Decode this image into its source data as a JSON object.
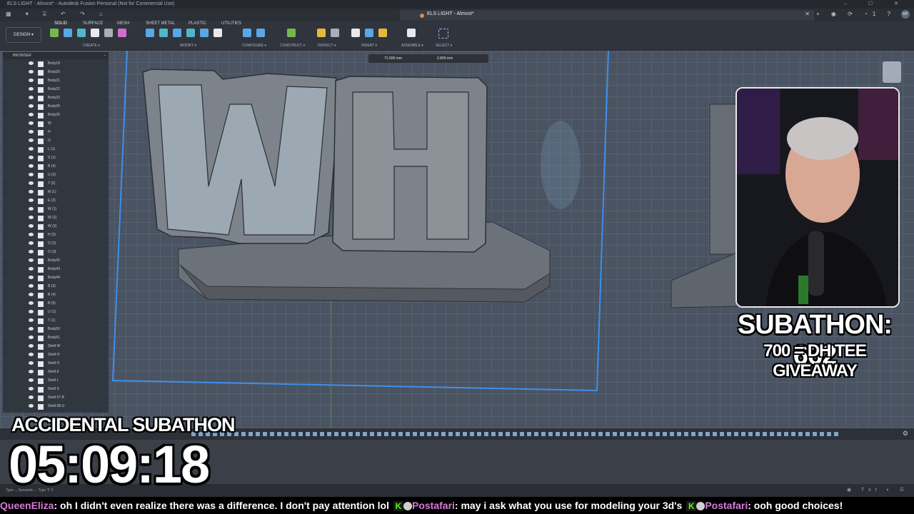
{
  "titlebar": {
    "title": "ELS LIGHT - Almost* - Autodesk Fusion Personal (Not for Commercial Use)",
    "controls": "–  ☐  ✕"
  },
  "tabbar": {
    "doc_tab": "ELS LIGHT - Almost*",
    "close": "✕",
    "right_icons": "+  ◉  ⟳  ◔1  ?",
    "avatar": "KP"
  },
  "toolbar": {
    "workspace": "DESIGN ▾",
    "tabs": [
      "SOLID",
      "SURFACE",
      "MESH",
      "SHEET METAL",
      "PLASTIC",
      "UTILITIES"
    ],
    "groups": [
      "CREATE ▾",
      "MODIFY ▾",
      "CONFIGURE ▾",
      "CONSTRUCT ▾",
      "INSPECT ▾",
      "INSERT ▾",
      "ASSEMBLE ▾",
      "SELECT ▾"
    ]
  },
  "measure": {
    "value1": "71.506 mm",
    "value2": "2.809 mm"
  },
  "browser": {
    "title": "BROWSER",
    "min": "–",
    "items": [
      "Body19",
      "Body20",
      "Body21",
      "Body22",
      "Body23",
      "Body24",
      "Body25",
      "W",
      "H",
      "O",
      "L (1)",
      "S (1)",
      "B (4)",
      "U (2)",
      "T (2)",
      "M (1)",
      "E (2)",
      "W (1)",
      "W (2)",
      "W (3)",
      "H (2)",
      "O (2)",
      "O (3)",
      "Body42",
      "Body43",
      "Body44",
      "B (3)",
      "B (4)",
      "B (5)",
      "U (1)",
      "T (1)",
      "Body50",
      "Body51",
      "Shell W",
      "Shell H",
      "Shell O",
      "Shell E",
      "Shell L",
      "Shell S",
      "Shell 07 B",
      "Shell 08 U"
    ]
  },
  "overlay": {
    "subathon_count": "SUBATHON: 662",
    "giveaway": "700 = DH TEE GIVEAWAY",
    "accidental": "ACCIDENTAL SUBATHON",
    "timer": "05:09:18"
  },
  "statusbar": {
    "left": "Type  ...  Semantic  ...  Type 'F' F",
    "right": "◉ Txt ◐ ☰"
  },
  "chat": [
    {
      "user": "QueenEliza",
      "message": ": oh I didn't even realize there was a difference. I don't pay attention lol"
    },
    {
      "user": "Postafari",
      "message": ": may i ask what you use for modeling your 3d's"
    },
    {
      "user": "Postafari",
      "message": ": ooh good choices!"
    }
  ],
  "colors": {
    "accent": "#5aa7e6",
    "sketch_line": "#3d8ff0",
    "chat_user": "#d77bd9",
    "kick_green": "#53fc18"
  }
}
